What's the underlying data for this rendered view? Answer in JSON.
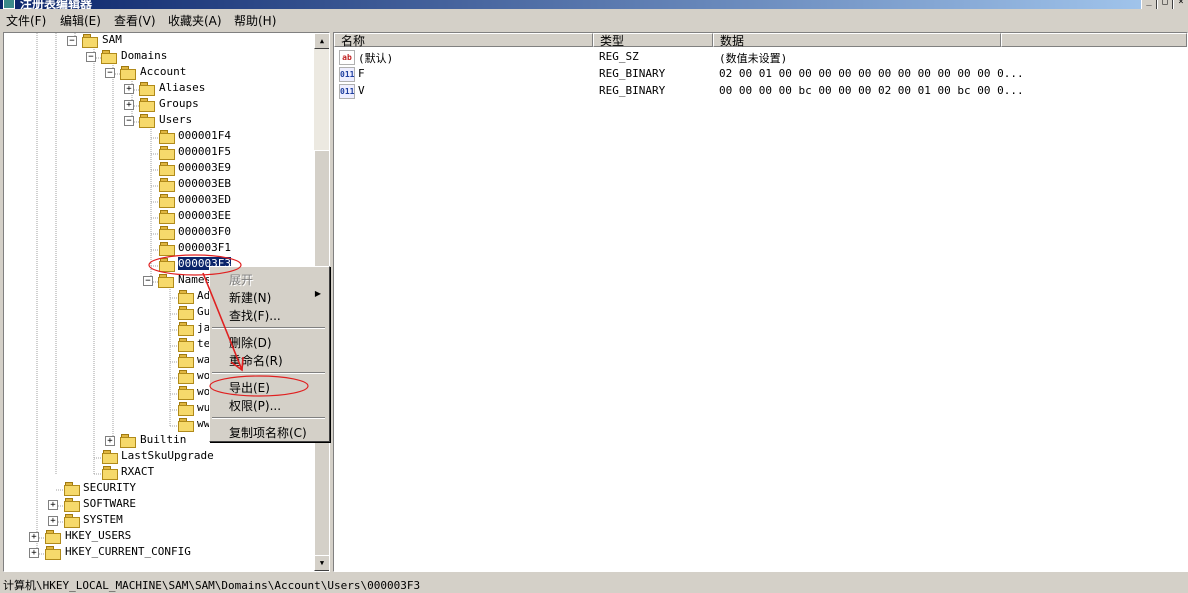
{
  "window": {
    "title": "注册表编辑器",
    "btn_min": "_",
    "btn_max": "□",
    "btn_close": "×"
  },
  "menu": [
    "文件(F)",
    "编辑(E)",
    "查看(V)",
    "收藏夹(A)",
    "帮助(H)"
  ],
  "tree": {
    "sam": "SAM",
    "domains": "Domains",
    "account": "Account",
    "aliases": "Aliases",
    "groups": "Groups",
    "users": "Users",
    "user_keys": [
      "000001F4",
      "000001F5",
      "000003E9",
      "000003EB",
      "000003ED",
      "000003EE",
      "000003F0",
      "000003F1"
    ],
    "selected": "000003F3",
    "names": "Names",
    "name_children": [
      "Ad",
      "Gu",
      "ja",
      "te",
      "wa",
      "wo",
      "wo",
      "wu",
      "ww"
    ],
    "builtin": "Builtin",
    "lastsku": "LastSkuUpgrade",
    "rxact": "RXACT",
    "security": "SECURITY",
    "software": "SOFTWARE",
    "system": "SYSTEM",
    "hkey_users": "HKEY_USERS",
    "hkey_current_config": "HKEY_CURRENT_CONFIG",
    "expand": "+",
    "collapse": "−"
  },
  "list": {
    "headers": {
      "name": "名称",
      "type": "类型",
      "data": "数据"
    },
    "rows": [
      {
        "icon": "ab",
        "name": "(默认)",
        "type": "REG_SZ",
        "data": "(数值未设置)"
      },
      {
        "icon": "011",
        "name": "F",
        "type": "REG_BINARY",
        "data": "02 00 01 00 00 00 00 00 00 00 00 00 00 00 0..."
      },
      {
        "icon": "011",
        "name": "V",
        "type": "REG_BINARY",
        "data": "00 00 00 00 bc 00 00 00 02 00 01 00 bc 00 0..."
      }
    ]
  },
  "context_menu": {
    "expand": "展开",
    "new": "新建(N)",
    "find": "查找(F)...",
    "delete": "删除(D)",
    "rename": "重命名(R)",
    "export": "导出(E)",
    "permissions": "权限(P)...",
    "copy_key_name": "复制项名称(C)",
    "submenu_arrow": "▶"
  },
  "scrollbar": {
    "up": "▲",
    "down": "▼"
  },
  "statusbar": {
    "path": "计算机\\HKEY_LOCAL_MACHINE\\SAM\\SAM\\Domains\\Account\\Users\\000003F3"
  },
  "colors": {
    "selection": "#0a246a",
    "annotation": "#e02020",
    "titlebar": "#0a246a"
  }
}
